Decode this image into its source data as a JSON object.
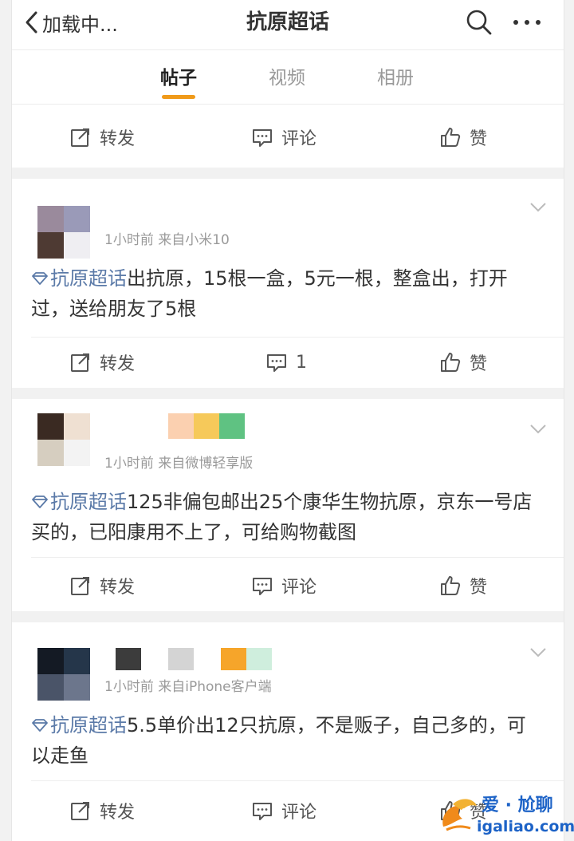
{
  "header": {
    "back_label": "加载中...",
    "title": "抗原超话"
  },
  "tabs": [
    {
      "label": "帖子"
    },
    {
      "label": "视频"
    },
    {
      "label": "相册"
    }
  ],
  "top_actions": {
    "repost": "转发",
    "comment": "评论",
    "like": "赞"
  },
  "posts": [
    {
      "meta": "1小时前  来自小米10",
      "tag": "抗原超话",
      "body": "出抗原，15根一盒，5元一根，整盒出，打开过，送给朋友了5根",
      "actions": {
        "repost": "转发",
        "comment": "1",
        "like": "赞"
      }
    },
    {
      "meta": "1小时前  来自微博轻享版",
      "tag": "抗原超话",
      "body": "125非偏包邮出25个康华生物抗原，京东一号店买的，已阳康用不上了，可给购物截图",
      "actions": {
        "repost": "转发",
        "comment": "评论",
        "like": "赞"
      }
    },
    {
      "meta": "1小时前  来自iPhone客户端",
      "tag": "抗原超话",
      "body": "5.5单价出12只抗原，不是贩子，自己多的，可以走鱼",
      "actions": {
        "repost": "转发",
        "comment": "评论",
        "like": "赞"
      }
    }
  ],
  "watermark": {
    "text": "爱 · 尬聊",
    "url_text": "igaliao.com"
  },
  "colors": {
    "accent": "#f09a1a",
    "tag": "#5b7aa8",
    "meta": "#9a9a9a"
  }
}
